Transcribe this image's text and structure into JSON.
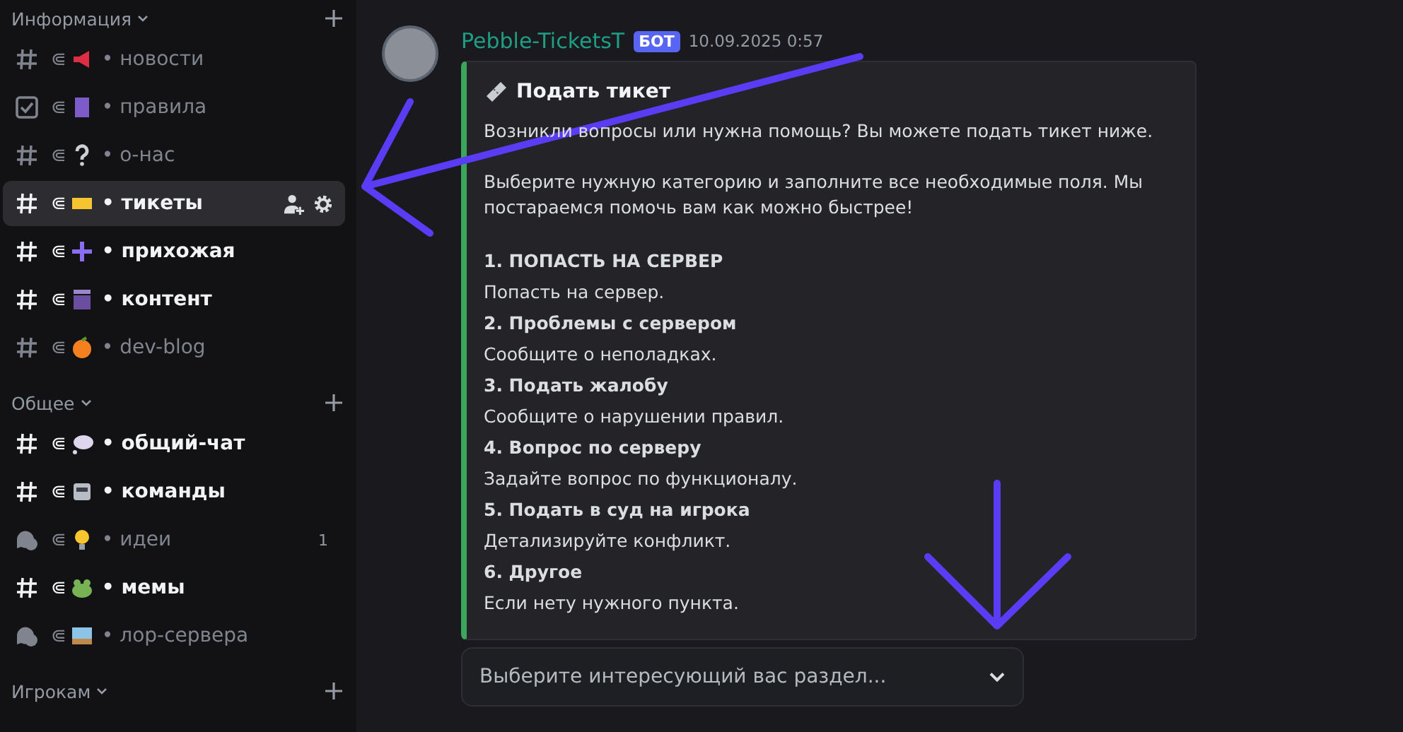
{
  "sidebar": {
    "categories": [
      {
        "title": "Информация",
        "channels": [
          {
            "kind": "hash",
            "prefix": "⋐",
            "label": "• новости",
            "unread": false,
            "selected": false
          },
          {
            "kind": "rules",
            "prefix": "⋐",
            "label": "• правила",
            "unread": false,
            "selected": false
          },
          {
            "kind": "hash",
            "prefix": "⋐",
            "label": "• о-нас",
            "unread": false,
            "selected": false
          },
          {
            "kind": "hash",
            "prefix": "⋐",
            "label": "• тикеты",
            "unread": true,
            "selected": true
          },
          {
            "kind": "hash",
            "prefix": "⋐",
            "label": "• прихожая",
            "unread": true,
            "selected": false
          },
          {
            "kind": "hash",
            "prefix": "⋐",
            "label": "• контент",
            "unread": true,
            "selected": false
          },
          {
            "kind": "hash",
            "prefix": "⋐",
            "label": "• dev-blog",
            "unread": false,
            "selected": false
          }
        ]
      },
      {
        "title": "Общее",
        "channels": [
          {
            "kind": "hash",
            "prefix": "⋐",
            "label": "• общий-чат",
            "unread": true,
            "selected": false
          },
          {
            "kind": "hash",
            "prefix": "⋐",
            "label": "• команды",
            "unread": true,
            "selected": false
          },
          {
            "kind": "forum",
            "prefix": "⋐",
            "label": "• идеи",
            "unread": false,
            "selected": false,
            "badge": "1"
          },
          {
            "kind": "hash",
            "prefix": "⋐",
            "label": "• мемы",
            "unread": true,
            "selected": false
          },
          {
            "kind": "forum",
            "prefix": "⋐",
            "label": "• лор-сервера",
            "unread": false,
            "selected": false
          }
        ]
      },
      {
        "title": "Игрокам"
      }
    ]
  },
  "message": {
    "author": "Pebble-TicketsT",
    "tag": "БОТ",
    "time": "10.09.2025 0:57",
    "embed": {
      "title": "Подать тикет",
      "paragraphs": [
        "Возникли вопросы или нужна помощь? Вы можете подать тикет ниже.",
        "Выберите нужную категорию и заполните все необходимые поля. Мы постараемся помочь вам как можно быстрее!"
      ],
      "sections": [
        {
          "heading": "1. ПОПАСТЬ НА СЕРВЕР",
          "text": "Попасть на сервер."
        },
        {
          "heading": "2. Проблемы с сервером",
          "text": "Сообщите о неполадках."
        },
        {
          "heading": "3. Подать жалобу",
          "text": "Сообщите о нарушении правил."
        },
        {
          "heading": "4. Вопрос по серверу",
          "text": "Задайте вопрос по функционалу."
        },
        {
          "heading": "5. Подать в суд на игрока",
          "text": "Детализируйте конфликт."
        },
        {
          "heading": "6. Другое",
          "text": "Если нету нужного пункта."
        }
      ]
    },
    "select": {
      "placeholder": "Выберите интересующий вас раздел..."
    }
  }
}
